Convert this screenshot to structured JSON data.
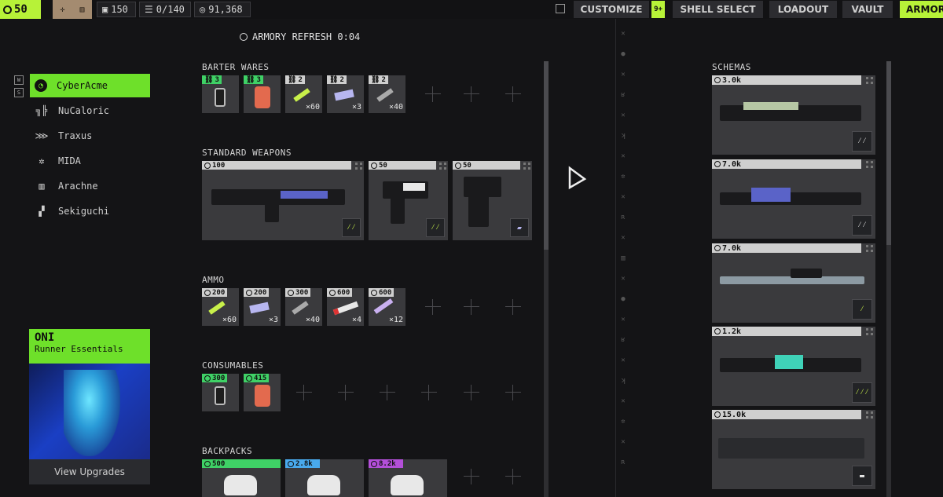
{
  "topbar": {
    "level": "50",
    "stat_cube": "150",
    "stat_storage": "0/140",
    "stat_credits": "91,368",
    "nav": {
      "customize": "CUSTOMIZE",
      "customize_badge": "9+",
      "shell_select": "SHELL SELECT",
      "loadout": "LOADOUT",
      "vault": "VAULT",
      "armory": "ARMOR"
    }
  },
  "refresh": {
    "label": "ARMORY REFRESH 0:04"
  },
  "vendors": [
    {
      "label": "CyberAcme",
      "icon": "cyberacme-icon",
      "active": true
    },
    {
      "label": "NuCaloric",
      "icon": "nucaloric-icon",
      "active": false
    },
    {
      "label": "Traxus",
      "icon": "traxus-icon",
      "active": false
    },
    {
      "label": "MIDA",
      "icon": "mida-icon",
      "active": false
    },
    {
      "label": "Arachne",
      "icon": "arachne-icon",
      "active": false
    },
    {
      "label": "Sekiguchi",
      "icon": "sekiguchi-icon",
      "active": false
    }
  ],
  "hotkeys": [
    "W",
    "S"
  ],
  "promo": {
    "title": "ONI",
    "subtitle": "Runner Essentials",
    "button": "View Upgrades"
  },
  "sections": {
    "barter": "BARTER WARES",
    "weapons": "STANDARD WEAPONS",
    "ammo": "AMMO",
    "consumables": "CONSUMABLES",
    "backpacks": "BACKPACKS",
    "schemas": "SCHEMAS"
  },
  "barter_items": [
    {
      "price": "3",
      "qty": ""
    },
    {
      "price": "3",
      "qty": ""
    },
    {
      "price": "2",
      "qty": "×60"
    },
    {
      "price": "2",
      "qty": "×3"
    },
    {
      "price": "2",
      "qty": "×40"
    }
  ],
  "weapon_items": [
    {
      "price": "100"
    },
    {
      "price": "50"
    },
    {
      "price": "50"
    }
  ],
  "ammo_items": [
    {
      "price": "200",
      "qty": "×60"
    },
    {
      "price": "200",
      "qty": "×3"
    },
    {
      "price": "300",
      "qty": "×40"
    },
    {
      "price": "600",
      "qty": "×4"
    },
    {
      "price": "600",
      "qty": "×12"
    }
  ],
  "consumable_items": [
    {
      "price": "300"
    },
    {
      "price": "415"
    }
  ],
  "backpack_items": [
    {
      "price": "500"
    },
    {
      "price": "2.8k"
    },
    {
      "price": "8.2k"
    }
  ],
  "schema_items": [
    {
      "price": "3.0k"
    },
    {
      "price": "7.0k"
    },
    {
      "price": "7.0k"
    },
    {
      "price": "1.2k"
    },
    {
      "price": "15.0k"
    }
  ],
  "colors": {
    "accent": "#b7f238",
    "vendor_active": "#6ee02a",
    "price_green": "#3fd166",
    "price_blue": "#49a9ec",
    "price_purple": "#b34fd8"
  }
}
